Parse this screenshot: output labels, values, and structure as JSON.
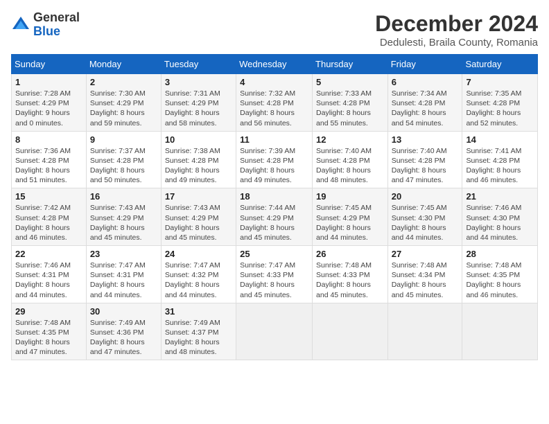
{
  "header": {
    "logo_general": "General",
    "logo_blue": "Blue",
    "month_title": "December 2024",
    "location": "Dedulesti, Braila County, Romania"
  },
  "weekdays": [
    "Sunday",
    "Monday",
    "Tuesday",
    "Wednesday",
    "Thursday",
    "Friday",
    "Saturday"
  ],
  "weeks": [
    [
      {
        "day": "1",
        "sunrise": "7:28 AM",
        "sunset": "4:29 PM",
        "daylight": "9 hours and 0 minutes."
      },
      {
        "day": "2",
        "sunrise": "7:30 AM",
        "sunset": "4:29 PM",
        "daylight": "8 hours and 59 minutes."
      },
      {
        "day": "3",
        "sunrise": "7:31 AM",
        "sunset": "4:29 PM",
        "daylight": "8 hours and 58 minutes."
      },
      {
        "day": "4",
        "sunrise": "7:32 AM",
        "sunset": "4:28 PM",
        "daylight": "8 hours and 56 minutes."
      },
      {
        "day": "5",
        "sunrise": "7:33 AM",
        "sunset": "4:28 PM",
        "daylight": "8 hours and 55 minutes."
      },
      {
        "day": "6",
        "sunrise": "7:34 AM",
        "sunset": "4:28 PM",
        "daylight": "8 hours and 54 minutes."
      },
      {
        "day": "7",
        "sunrise": "7:35 AM",
        "sunset": "4:28 PM",
        "daylight": "8 hours and 52 minutes."
      }
    ],
    [
      {
        "day": "8",
        "sunrise": "7:36 AM",
        "sunset": "4:28 PM",
        "daylight": "8 hours and 51 minutes."
      },
      {
        "day": "9",
        "sunrise": "7:37 AM",
        "sunset": "4:28 PM",
        "daylight": "8 hours and 50 minutes."
      },
      {
        "day": "10",
        "sunrise": "7:38 AM",
        "sunset": "4:28 PM",
        "daylight": "8 hours and 49 minutes."
      },
      {
        "day": "11",
        "sunrise": "7:39 AM",
        "sunset": "4:28 PM",
        "daylight": "8 hours and 49 minutes."
      },
      {
        "day": "12",
        "sunrise": "7:40 AM",
        "sunset": "4:28 PM",
        "daylight": "8 hours and 48 minutes."
      },
      {
        "day": "13",
        "sunrise": "7:40 AM",
        "sunset": "4:28 PM",
        "daylight": "8 hours and 47 minutes."
      },
      {
        "day": "14",
        "sunrise": "7:41 AM",
        "sunset": "4:28 PM",
        "daylight": "8 hours and 46 minutes."
      }
    ],
    [
      {
        "day": "15",
        "sunrise": "7:42 AM",
        "sunset": "4:28 PM",
        "daylight": "8 hours and 46 minutes."
      },
      {
        "day": "16",
        "sunrise": "7:43 AM",
        "sunset": "4:29 PM",
        "daylight": "8 hours and 45 minutes."
      },
      {
        "day": "17",
        "sunrise": "7:43 AM",
        "sunset": "4:29 PM",
        "daylight": "8 hours and 45 minutes."
      },
      {
        "day": "18",
        "sunrise": "7:44 AM",
        "sunset": "4:29 PM",
        "daylight": "8 hours and 45 minutes."
      },
      {
        "day": "19",
        "sunrise": "7:45 AM",
        "sunset": "4:29 PM",
        "daylight": "8 hours and 44 minutes."
      },
      {
        "day": "20",
        "sunrise": "7:45 AM",
        "sunset": "4:30 PM",
        "daylight": "8 hours and 44 minutes."
      },
      {
        "day": "21",
        "sunrise": "7:46 AM",
        "sunset": "4:30 PM",
        "daylight": "8 hours and 44 minutes."
      }
    ],
    [
      {
        "day": "22",
        "sunrise": "7:46 AM",
        "sunset": "4:31 PM",
        "daylight": "8 hours and 44 minutes."
      },
      {
        "day": "23",
        "sunrise": "7:47 AM",
        "sunset": "4:31 PM",
        "daylight": "8 hours and 44 minutes."
      },
      {
        "day": "24",
        "sunrise": "7:47 AM",
        "sunset": "4:32 PM",
        "daylight": "8 hours and 44 minutes."
      },
      {
        "day": "25",
        "sunrise": "7:47 AM",
        "sunset": "4:33 PM",
        "daylight": "8 hours and 45 minutes."
      },
      {
        "day": "26",
        "sunrise": "7:48 AM",
        "sunset": "4:33 PM",
        "daylight": "8 hours and 45 minutes."
      },
      {
        "day": "27",
        "sunrise": "7:48 AM",
        "sunset": "4:34 PM",
        "daylight": "8 hours and 45 minutes."
      },
      {
        "day": "28",
        "sunrise": "7:48 AM",
        "sunset": "4:35 PM",
        "daylight": "8 hours and 46 minutes."
      }
    ],
    [
      {
        "day": "29",
        "sunrise": "7:48 AM",
        "sunset": "4:35 PM",
        "daylight": "8 hours and 47 minutes."
      },
      {
        "day": "30",
        "sunrise": "7:49 AM",
        "sunset": "4:36 PM",
        "daylight": "8 hours and 47 minutes."
      },
      {
        "day": "31",
        "sunrise": "7:49 AM",
        "sunset": "4:37 PM",
        "daylight": "8 hours and 48 minutes."
      },
      null,
      null,
      null,
      null
    ]
  ],
  "labels": {
    "sunrise": "Sunrise:",
    "sunset": "Sunset:",
    "daylight": "Daylight:"
  }
}
